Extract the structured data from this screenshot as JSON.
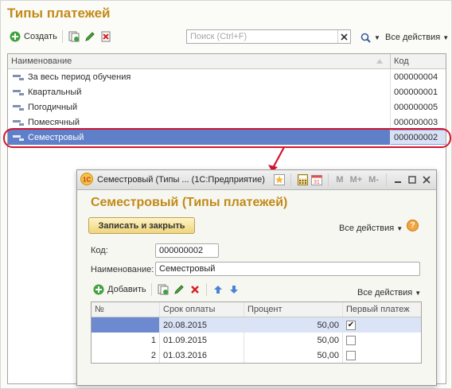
{
  "main": {
    "title": "Типы платежей",
    "toolbar": {
      "create_label": "Создать",
      "search_placeholder": "Поиск (Ctrl+F)",
      "all_actions_label": "Все действия"
    },
    "list": {
      "columns": [
        "Наименование",
        "Код"
      ],
      "rows": [
        {
          "name": "За весь период обучения",
          "code": "000000004"
        },
        {
          "name": "Квартальный",
          "code": "000000001"
        },
        {
          "name": "Погодичный",
          "code": "000000005"
        },
        {
          "name": "Помесячный",
          "code": "000000003"
        },
        {
          "name": "Семестровый",
          "code": "000000002",
          "selected": true
        }
      ]
    }
  },
  "dialog": {
    "window_title": "Семестровый (Типы ... (1С:Предприятие)",
    "title_bar_labels": [
      "M",
      "M+",
      "M-"
    ],
    "heading": "Семестровый (Типы платежей)",
    "save_close_label": "Записать и закрыть",
    "all_actions_label": "Все действия",
    "help_label": "?",
    "code_label": "Код:",
    "code_value": "000000002",
    "name_label": "Наименование:",
    "name_value": "Семестровый",
    "add_label": "Добавить",
    "table_all_actions_label": "Все действия",
    "table": {
      "columns": [
        "№",
        "Срок оплаты",
        "Процент",
        "Первый платеж"
      ],
      "rows": [
        {
          "n": "",
          "date": "20.08.2015",
          "percent": "50,00",
          "first": true
        },
        {
          "n": "1",
          "date": "01.09.2015",
          "percent": "50,00",
          "first": false
        },
        {
          "n": "2",
          "date": "01.03.2016",
          "percent": "50,00",
          "first": false
        }
      ]
    }
  },
  "colors": {
    "title": "#c18a17",
    "selection": "#5f7fc8",
    "highlight_oval": "#d3152f"
  }
}
